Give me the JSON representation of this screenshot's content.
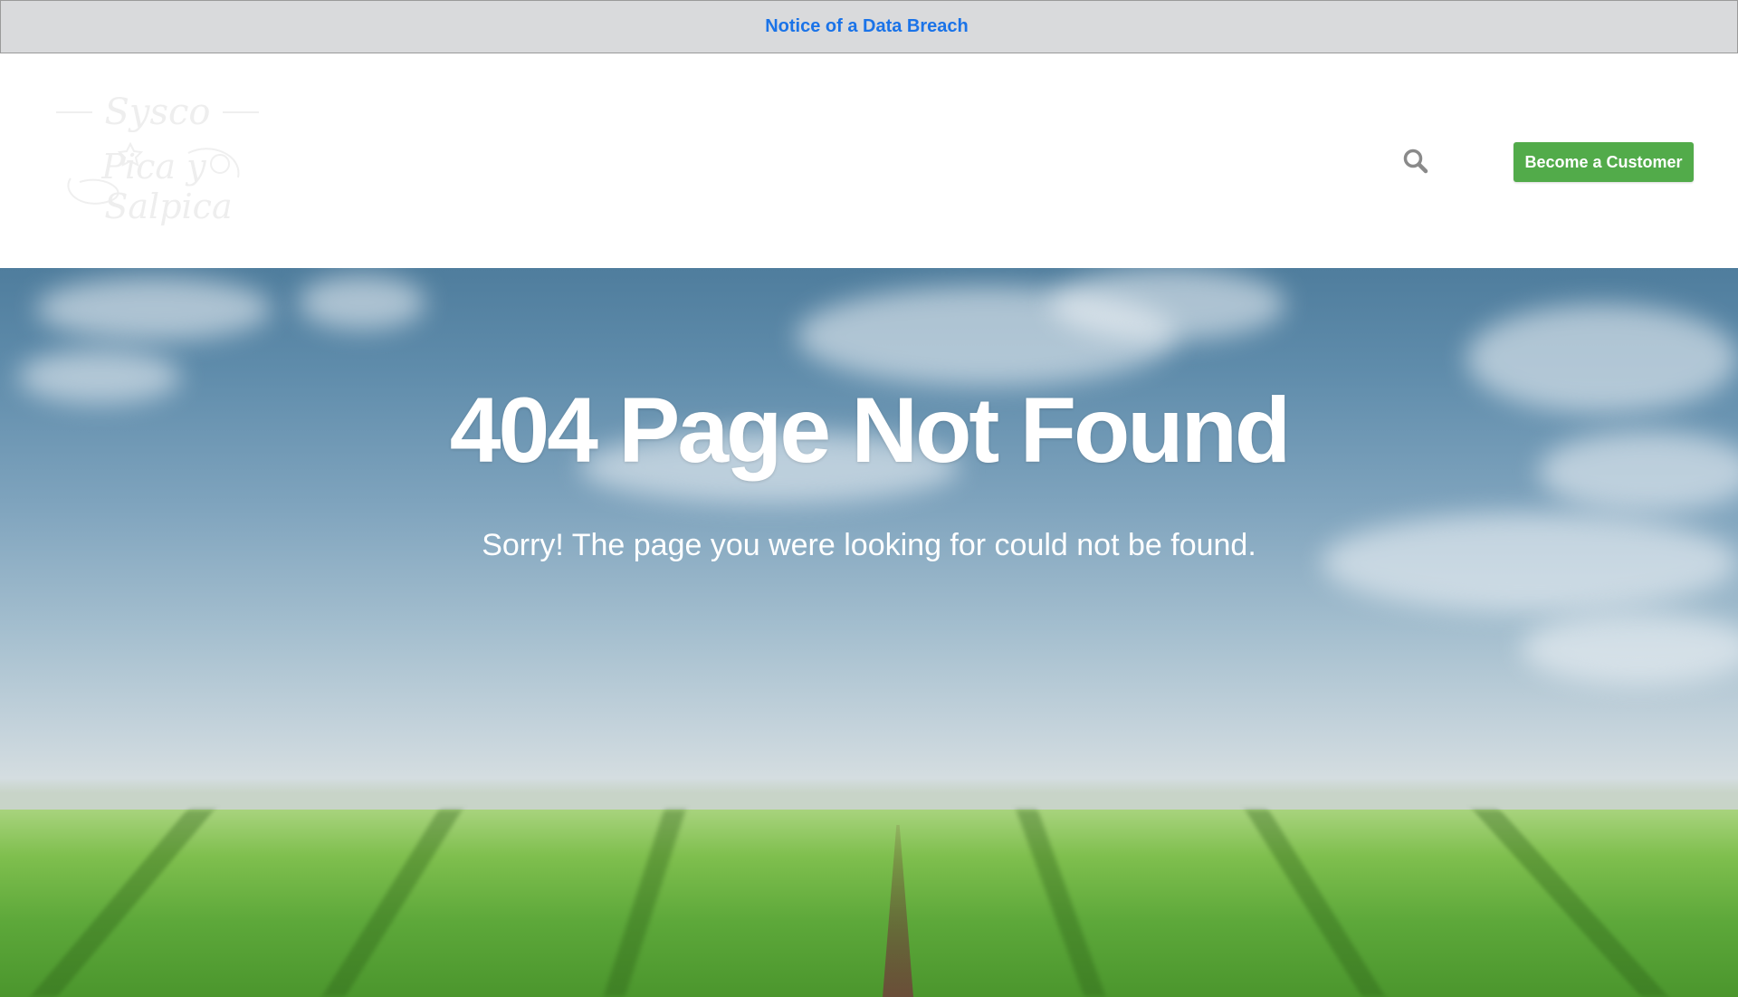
{
  "notice_bar": {
    "link_text": "Notice of a Data Breach"
  },
  "header": {
    "logo_text": [
      "Sysco",
      "Pica y",
      "Salpica"
    ],
    "search_icon": "search-icon",
    "cta_label": "Become a Customer"
  },
  "hero": {
    "title": "404 Page Not Found",
    "subtitle": "Sorry! The page you were looking for could not be found."
  },
  "colors": {
    "notice_bg": "#d9dadc",
    "notice_link": "#1a73e8",
    "cta_bg": "#52ab4a",
    "search_icon": "#8a8a8a"
  }
}
